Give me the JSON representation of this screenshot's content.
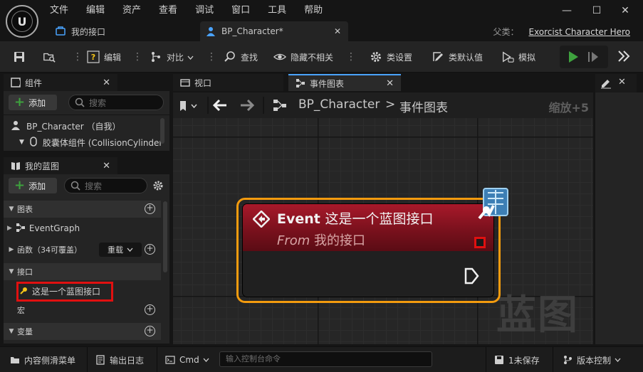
{
  "menu": [
    "文件",
    "编辑",
    "资产",
    "查看",
    "调试",
    "窗口",
    "工具",
    "帮助"
  ],
  "window": {
    "minimize": "—",
    "maximize": "☐",
    "close": "✕"
  },
  "doc_tabs": [
    {
      "label": "我的接口"
    },
    {
      "label": "BP_Character*",
      "close": "✕"
    }
  ],
  "parent": {
    "label": "父类：",
    "value": "Exorcist Character Hero"
  },
  "toolbar": {
    "compile": "编辑",
    "diff": "对比",
    "find": "查找",
    "hide_unrelated": "隐藏不相关",
    "class_settings": "类设置",
    "class_defaults": "类默认值",
    "simulate": "模拟"
  },
  "components_panel": {
    "title": "组件",
    "add": "添加",
    "search_placeholder": "搜索",
    "root": "BP_Character （自我）",
    "child": "胶囊体组件 (CollisionCylinder"
  },
  "my_blueprint": {
    "title": "我的蓝图",
    "add": "添加",
    "search_placeholder": "搜索",
    "graphs_section": "图表",
    "event_graph": "EventGraph",
    "functions_section": "函数（34可覆盖）",
    "overload": "重载",
    "interfaces_section": "接口",
    "interface_item": "这是一个蓝图接口",
    "macros_section": "宏",
    "variables_section": "变量"
  },
  "graph_tabs": {
    "viewport": "视口",
    "event_graph": "事件图表"
  },
  "graph": {
    "breadcrumb_root": "BP_Character",
    "breadcrumb_sep": ">",
    "breadcrumb_leaf": "事件图表",
    "zoom": "缩放+5",
    "watermark": "蓝图",
    "node_title_prefix": "Event",
    "node_title": "这是一个蓝图接口",
    "node_sub_prefix": "From",
    "node_sub": "我的接口"
  },
  "status": {
    "content_drawer": "内容侧滑菜单",
    "output_log": "输出日志",
    "cmd": "Cmd",
    "console_placeholder": "输入控制台命令",
    "unsaved": "1未保存",
    "source_control": "版本控制"
  },
  "colors": {
    "accent_orange": "#f39b0e",
    "node_red": "#a8192a",
    "highlight_red": "#e01010",
    "play_green": "#3ea23e"
  }
}
